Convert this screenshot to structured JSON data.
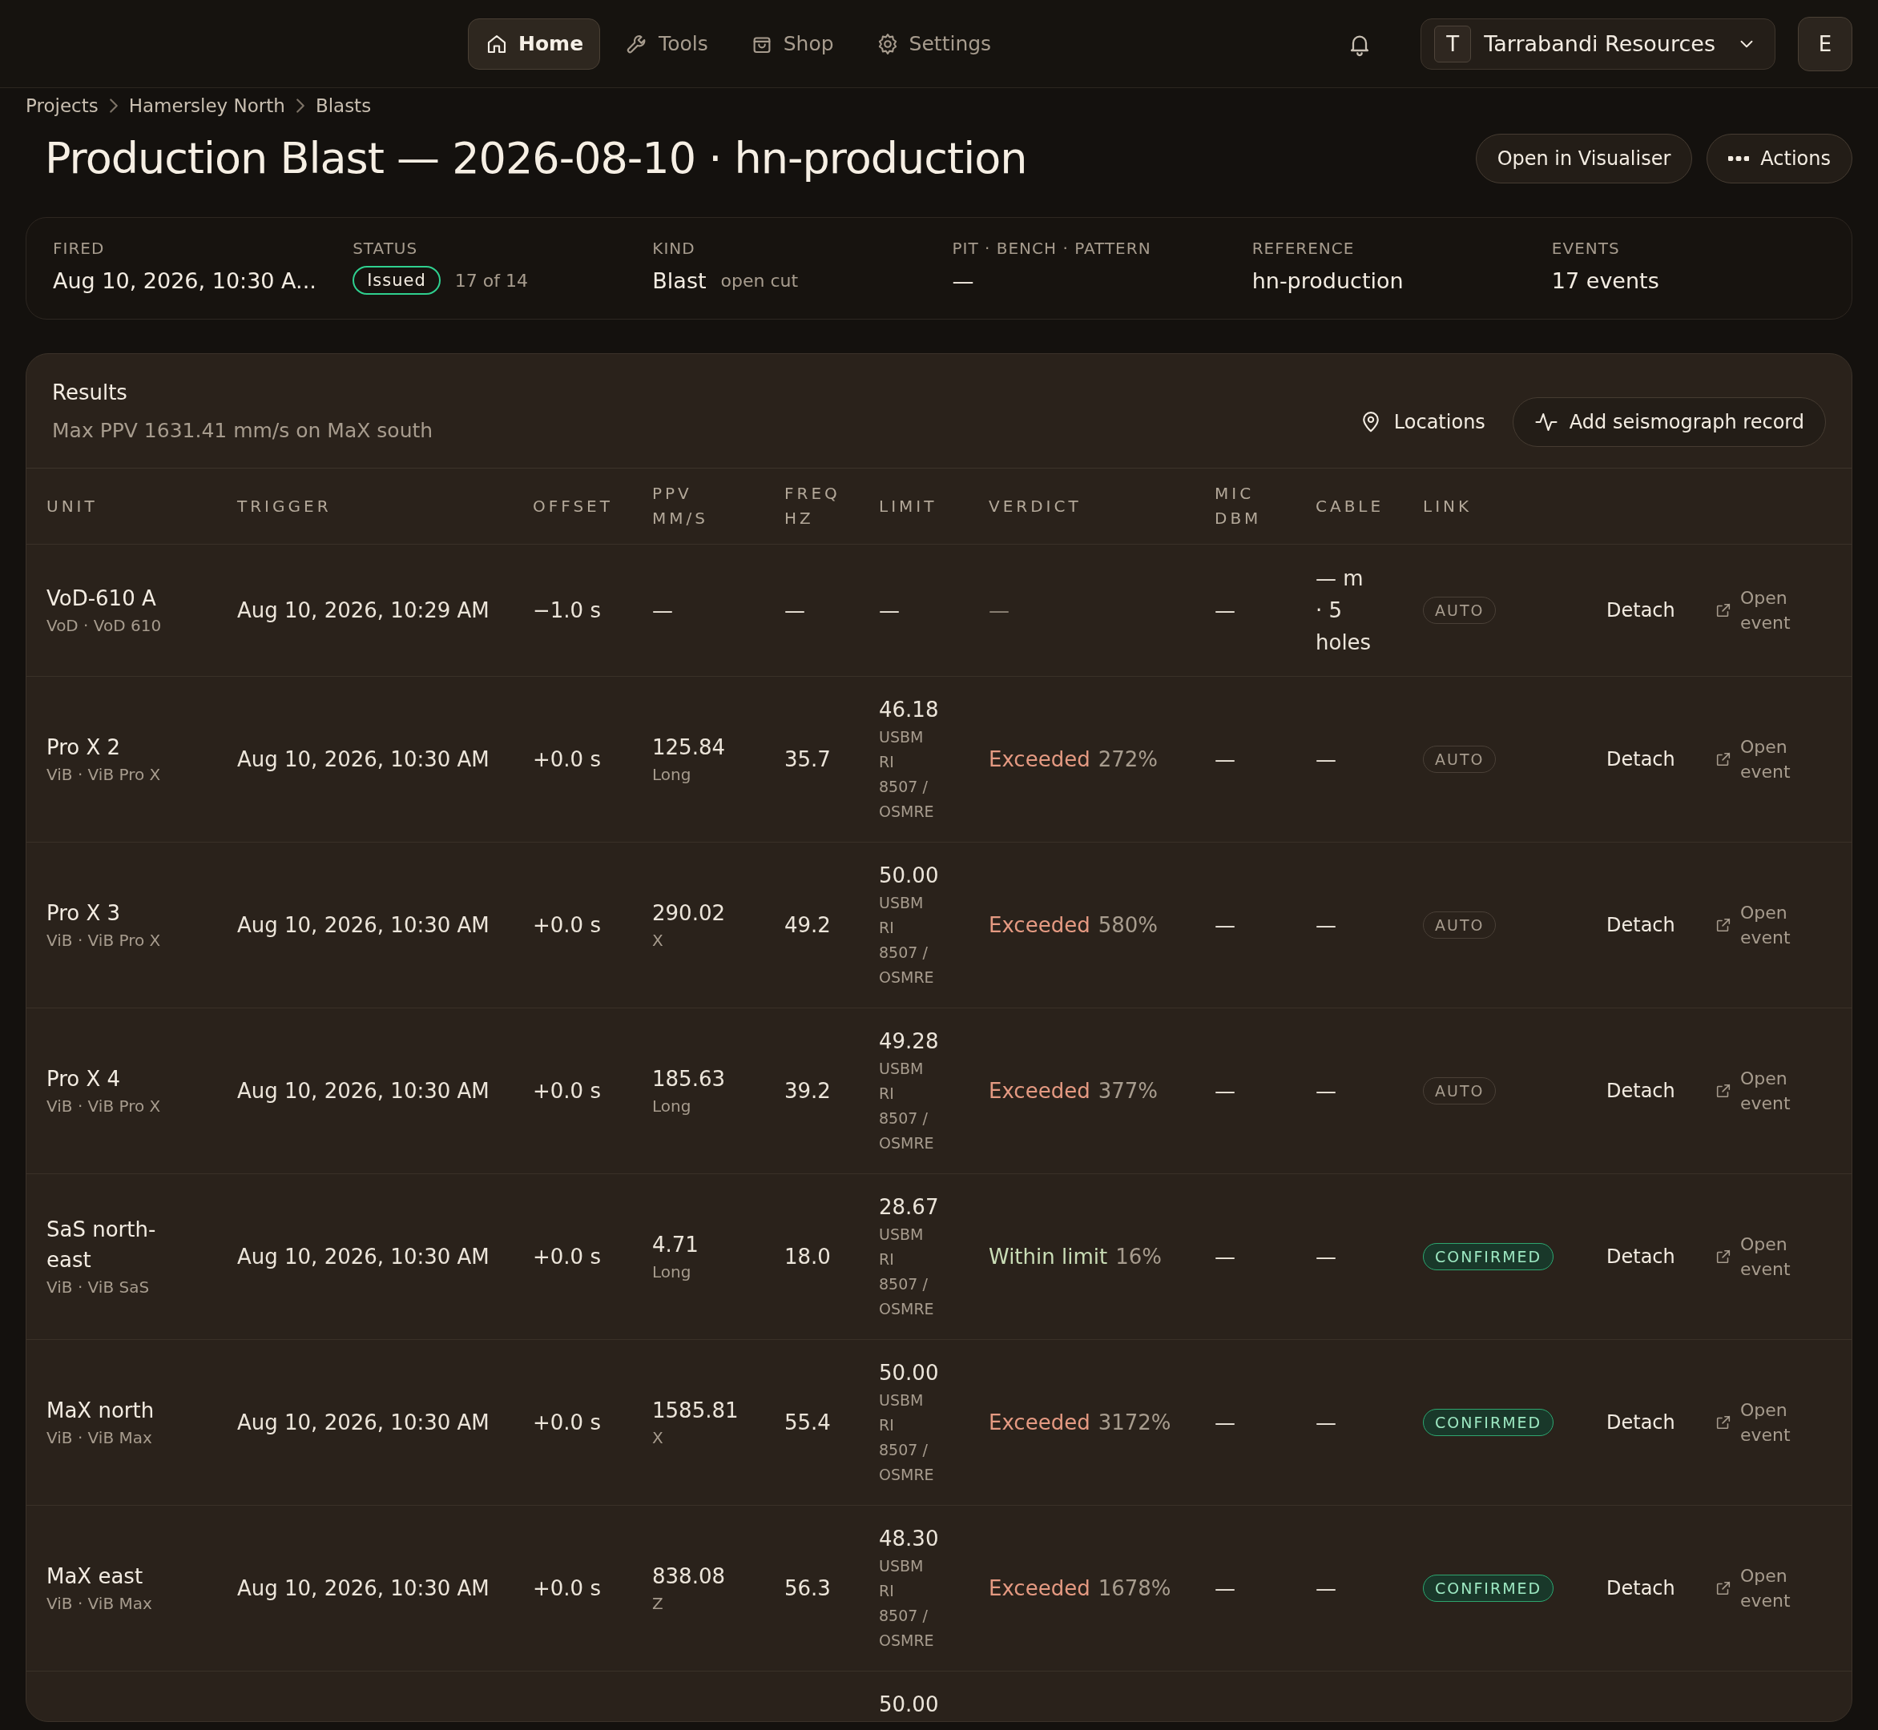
{
  "nav": {
    "tabs": [
      {
        "label": "Home",
        "selected": true
      },
      {
        "label": "Tools",
        "selected": false
      },
      {
        "label": "Shop",
        "selected": false
      },
      {
        "label": "Settings",
        "selected": false
      }
    ],
    "org": {
      "initial": "T",
      "name": "Tarrabandi Resources"
    },
    "avatar": "E"
  },
  "breadcrumbs": [
    "Projects",
    "Hamersley North",
    "Blasts"
  ],
  "title": "Production Blast — 2026-08-10 · hn-production",
  "header_buttons": [
    "Open in Visualiser",
    "Actions"
  ],
  "summary": [
    {
      "label": "FIRED",
      "value": "Aug 10, 2026, 10:30 A..."
    },
    {
      "label": "STATUS",
      "badge": "Issued",
      "note": "17 of 14"
    },
    {
      "label": "KIND",
      "value": "Blast",
      "note": "open cut"
    },
    {
      "label": "PIT · BENCH · PATTERN",
      "value": "—"
    },
    {
      "label": "REFERENCE",
      "value": "hn-production"
    },
    {
      "label": "EVENTS",
      "value": "17 events"
    }
  ],
  "results": {
    "title": "Results",
    "subtitle": "Max PPV 1631.41 mm/s on MaX south",
    "buttons": [
      "Locations",
      "Add seismograph record"
    ],
    "columns": [
      [
        "UNIT"
      ],
      [
        "TRIGGER"
      ],
      [
        "OFFSET"
      ],
      [
        "PPV",
        "MM/S"
      ],
      [
        "FREQ",
        "HZ"
      ],
      [
        "LIMIT"
      ],
      [
        "VERDICT"
      ],
      [
        "MIC",
        "DBM"
      ],
      [
        "CABLE"
      ],
      [
        "LINK"
      ]
    ],
    "rows": [
      {
        "unit": "VoD-610 A",
        "sub": "VoD · VoD 610",
        "trigger": "Aug 10, 2026, 10:29 AM",
        "offset": "−1.0 s",
        "ppv": "—",
        "freq": "—",
        "limit": "—",
        "verdict": {
          "kind": "none",
          "label": "—"
        },
        "mic": "—",
        "cable": "— m · 5 holes",
        "link": {
          "kind": "auto",
          "label": "AUTO"
        },
        "action": "Detach",
        "open": "Open event"
      },
      {
        "unit": "Pro X 2",
        "sub": "ViB · ViB Pro X",
        "trigger": "Aug 10, 2026, 10:30 AM",
        "offset": "+0.0 s",
        "ppv": "125.84",
        "axis": "Long",
        "freq": "35.7",
        "limit": "46.18",
        "standard": "USBM RI 8507 / OSMRE",
        "verdict": {
          "kind": "exceeded",
          "label": "Exceeded",
          "pct": "272%"
        },
        "mic": "—",
        "cable": "—",
        "link": {
          "kind": "auto",
          "label": "AUTO"
        },
        "action": "Detach",
        "open": "Open event"
      },
      {
        "unit": "Pro X 3",
        "sub": "ViB · ViB Pro X",
        "trigger": "Aug 10, 2026, 10:30 AM",
        "offset": "+0.0 s",
        "ppv": "290.02",
        "axis": "X",
        "freq": "49.2",
        "limit": "50.00",
        "standard": "USBM RI 8507 / OSMRE",
        "verdict": {
          "kind": "exceeded",
          "label": "Exceeded",
          "pct": "580%"
        },
        "mic": "—",
        "cable": "—",
        "link": {
          "kind": "auto",
          "label": "AUTO"
        },
        "action": "Detach",
        "open": "Open event"
      },
      {
        "unit": "Pro X 4",
        "sub": "ViB · ViB Pro X",
        "trigger": "Aug 10, 2026, 10:30 AM",
        "offset": "+0.0 s",
        "ppv": "185.63",
        "axis": "Long",
        "freq": "39.2",
        "limit": "49.28",
        "standard": "USBM RI 8507 / OSMRE",
        "verdict": {
          "kind": "exceeded",
          "label": "Exceeded",
          "pct": "377%"
        },
        "mic": "—",
        "cable": "—",
        "link": {
          "kind": "auto",
          "label": "AUTO"
        },
        "action": "Detach",
        "open": "Open event"
      },
      {
        "unit": "SaS north-east",
        "sub": "ViB · ViB SaS",
        "trigger": "Aug 10, 2026, 10:30 AM",
        "offset": "+0.0 s",
        "ppv": "4.71",
        "axis": "Long",
        "freq": "18.0",
        "limit": "28.67",
        "standard": "USBM RI 8507 / OSMRE",
        "verdict": {
          "kind": "within",
          "label": "Within limit",
          "pct": "16%"
        },
        "mic": "—",
        "cable": "—",
        "link": {
          "kind": "confirmed",
          "label": "CONFIRMED"
        },
        "action": "Detach",
        "open": "Open event"
      },
      {
        "unit": "MaX north",
        "sub": "ViB · ViB Max",
        "trigger": "Aug 10, 2026, 10:30 AM",
        "offset": "+0.0 s",
        "ppv": "1585.81",
        "axis": "X",
        "freq": "55.4",
        "limit": "50.00",
        "standard": "USBM RI 8507 / OSMRE",
        "verdict": {
          "kind": "exceeded",
          "label": "Exceeded",
          "pct": "3172%"
        },
        "mic": "—",
        "cable": "—",
        "link": {
          "kind": "confirmed",
          "label": "CONFIRMED"
        },
        "action": "Detach",
        "open": "Open event"
      },
      {
        "unit": "MaX east",
        "sub": "ViB · ViB Max",
        "trigger": "Aug 10, 2026, 10:30 AM",
        "offset": "+0.0 s",
        "ppv": "838.08",
        "axis": "Z",
        "freq": "56.3",
        "limit": "48.30",
        "standard": "USBM RI 8507 / OSMRE",
        "verdict": {
          "kind": "exceeded",
          "label": "Exceeded",
          "pct": "1678%"
        },
        "mic": "—",
        "cable": "—",
        "link": {
          "kind": "confirmed",
          "label": "CONFIRMED"
        },
        "action": "Detach",
        "open": "Open event"
      },
      {
        "limit": "50.00"
      }
    ]
  }
}
